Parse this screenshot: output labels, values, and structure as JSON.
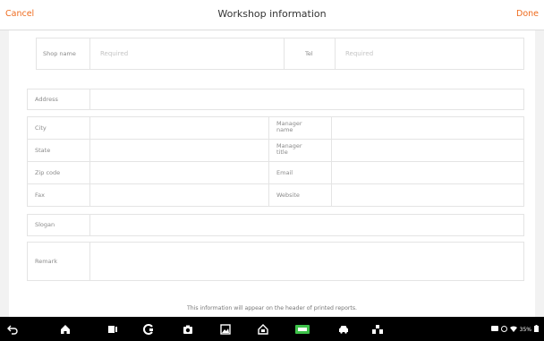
{
  "header": {
    "cancel_label": "Cancel",
    "title": "Workshop information",
    "done_label": "Done"
  },
  "form": {
    "shop_name_label": "Shop name",
    "shop_name_placeholder": "Required",
    "tel_label": "Tel",
    "tel_placeholder": "Required",
    "address_label": "Address",
    "city_label": "City",
    "state_label": "State",
    "zip_label": "Zip code",
    "fax_label": "Fax",
    "manager_name_label_line1": "Manager",
    "manager_name_label_line2": "name",
    "manager_title_label_line1": "Manager",
    "manager_title_label_line2": "title",
    "email_label": "Email",
    "website_label": "Website",
    "slogan_label": "Slogan",
    "remark_label": "Remark"
  },
  "footer_note": "This information will appear on the header of printed reports.",
  "navbar": {
    "icons": [
      "back-icon",
      "home-icon",
      "recent-apps-icon",
      "browser-icon",
      "camera-icon",
      "gallery-icon",
      "vci-home-icon",
      "vci-icon",
      "car-icon",
      "network-icon"
    ],
    "status_text": "35%"
  }
}
